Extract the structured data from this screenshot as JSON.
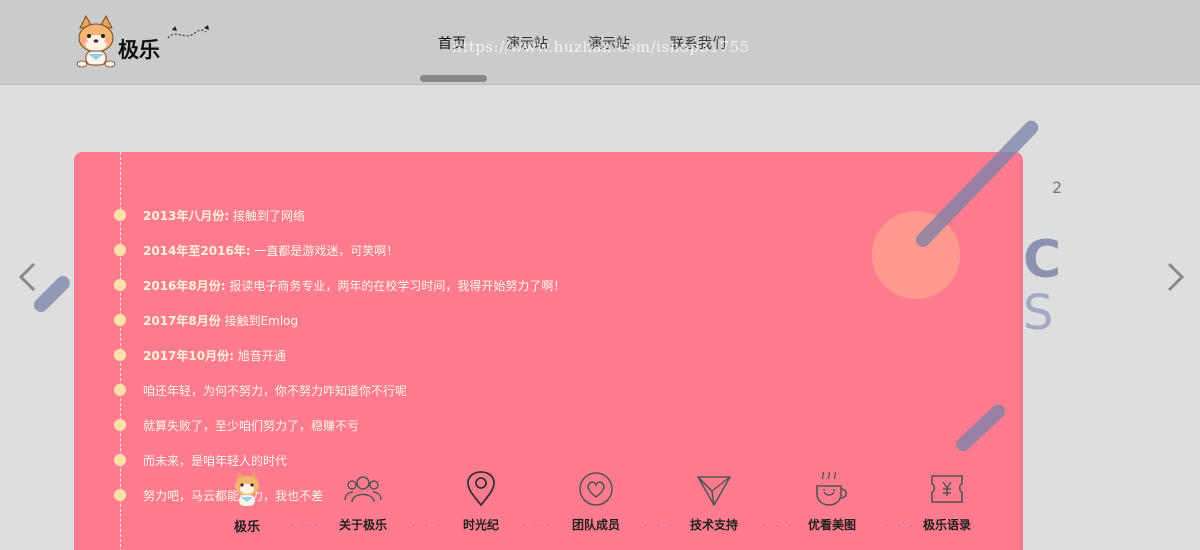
{
  "header": {
    "logo_text": "极乐",
    "nav": [
      {
        "label": "首页",
        "active": true
      },
      {
        "label": "演示站",
        "active": false
      },
      {
        "label": "演示站",
        "active": false
      },
      {
        "label": "联系我们",
        "active": false
      }
    ],
    "watermark": "https://www.huzhan.com/ishop31755"
  },
  "background": {
    "letter_c": "C",
    "letter_s": "S",
    "tick": "2"
  },
  "timeline": [
    {
      "date": "2013年八月份:",
      "text": " 接触到了网络"
    },
    {
      "date": "2014年至2016年:",
      "text": " 一直都是游戏迷，可笑啊！"
    },
    {
      "date": "2016年8月份:",
      "text": " 报读电子商务专业，两年的在校学习时间，我得开始努力了啊！"
    },
    {
      "date": "2017年8月份",
      "text": " 接触到Emlog"
    },
    {
      "date": "2017年10月份:",
      "text": " 旭音开通"
    },
    {
      "date": "",
      "text": "咱还年轻，为何不努力，你不努力咋知道你不行呢"
    },
    {
      "date": "",
      "text": "就算失败了，至少咱们努力了，稳赚不亏"
    },
    {
      "date": "",
      "text": "而未来，是咱年轻人的时代"
    },
    {
      "date": "",
      "text": "努力吧，马云都能努力，我也不差"
    }
  ],
  "bottom_nav": [
    {
      "label": "极乐",
      "icon": "shiba-avatar-icon"
    },
    {
      "label": "关于极乐",
      "icon": "users-icon"
    },
    {
      "label": "时光纪",
      "icon": "location-pin-icon"
    },
    {
      "label": "团队成员",
      "icon": "heart-circle-icon"
    },
    {
      "label": "技术支持",
      "icon": "paper-plane-icon"
    },
    {
      "label": "优看美图",
      "icon": "coffee-cup-icon"
    },
    {
      "label": "极乐语录",
      "icon": "ticket-yen-icon"
    }
  ],
  "bottom_nav_separator": "· · ·",
  "colors": {
    "header_bg": "#cbcbcb",
    "page_bg": "#dedede",
    "card_bg": "#ff7b8d",
    "circle": "#ff9a8e",
    "timeline_dot": "#fde2a8",
    "bar": "#7882aa"
  }
}
